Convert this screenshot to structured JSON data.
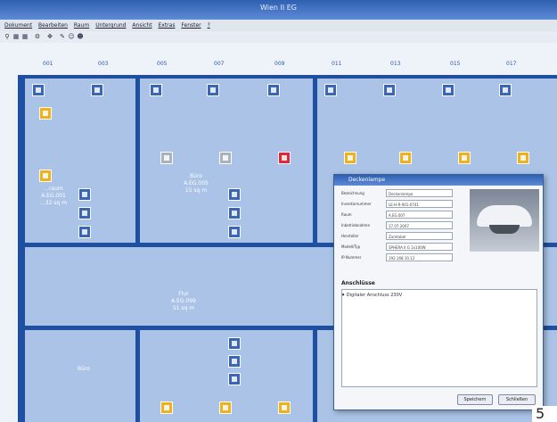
{
  "window": {
    "title": "Wien II EG"
  },
  "menu": [
    "Dokument",
    "Bearbeiten",
    "Raum",
    "Untergrund",
    "Ansicht",
    "Extras",
    "Fenster",
    "?"
  ],
  "room_numbers": [
    "001",
    "003",
    "005",
    "007",
    "009",
    "011",
    "013",
    "015",
    "017"
  ],
  "rooms": {
    "left_room": {
      "name": "...raum",
      "id": "A.EG.001",
      "area": "...32 sq m"
    },
    "buro_center": {
      "name": "Büro",
      "id": "A.EG.005",
      "area": "15 sq m"
    },
    "flur": {
      "name": "Flur",
      "id": "A.EG.099",
      "area": "51 sq m"
    },
    "buro_bottom": {
      "name": "Büro"
    }
  },
  "dialog": {
    "title": "Deckenlampe",
    "fields": [
      {
        "label": "Bezeichnung",
        "value": "Deckenlampe"
      },
      {
        "label": "Inventarnummer",
        "value": "LE-H-R-001-0741"
      },
      {
        "label": "Raum",
        "value": "A.EG.007"
      },
      {
        "label": "Inbetriebnahme",
        "value": "17.07.2007"
      },
      {
        "label": "Hersteller",
        "value": "Zumtobel"
      },
      {
        "label": "Modell/Typ",
        "value": "SPHERA II G 1x100W"
      },
      {
        "label": "IP-Nummer",
        "value": "192.168.10.12"
      }
    ],
    "section_title": "Anschlüsse",
    "connections": [
      "Digitaler Anschluss 230V"
    ],
    "buttons": {
      "save": "Speichern",
      "close": "Schließen"
    }
  },
  "page_number": "5",
  "colors": {
    "wall": "#1f4fa0",
    "room": "#aac3e6",
    "titlebar": "#2f5fb0",
    "device_yellow": "#f0b21c",
    "device_red": "#e0263a"
  }
}
